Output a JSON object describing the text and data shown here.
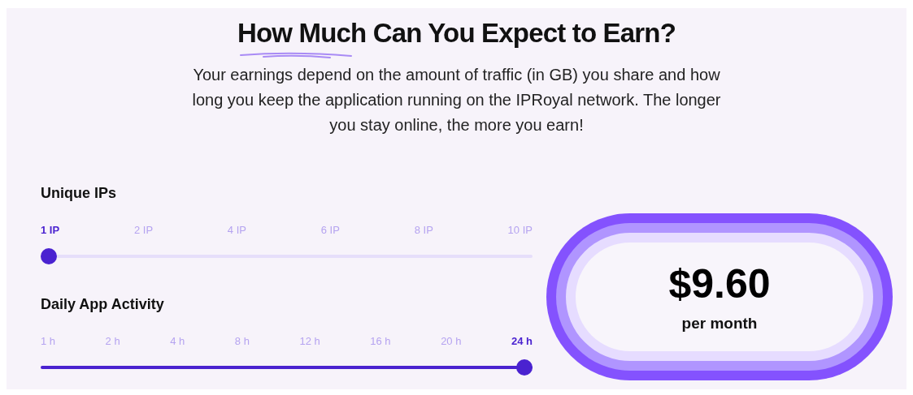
{
  "title": "How Much Can You Expect to Earn?",
  "description": "Your earnings depend on the amount of traffic (in GB) you share and how long you keep the application running on the IPRoyal network. The longer you stay online, the more you earn!",
  "sliders": [
    {
      "label": "Unique IPs",
      "level": 0,
      "ticks": [
        {
          "label": "1 IP",
          "selected": true
        },
        {
          "label": "2 IP",
          "selected": false
        },
        {
          "label": "4 IP",
          "selected": false
        },
        {
          "label": "6 IP",
          "selected": false
        },
        {
          "label": "8 IP",
          "selected": false
        },
        {
          "label": "10 IP",
          "selected": false
        }
      ]
    },
    {
      "label": "Daily App Activity",
      "level": 1,
      "ticks": [
        {
          "label": "1 h",
          "selected": false
        },
        {
          "label": "2 h",
          "selected": false
        },
        {
          "label": "4 h",
          "selected": false
        },
        {
          "label": "8 h",
          "selected": false
        },
        {
          "label": "12 h",
          "selected": false
        },
        {
          "label": "16 h",
          "selected": false
        },
        {
          "label": "20 h",
          "selected": false
        },
        {
          "label": "24 h",
          "selected": true
        }
      ]
    }
  ],
  "result": {
    "amount": "$9.60",
    "period": "per month"
  }
}
